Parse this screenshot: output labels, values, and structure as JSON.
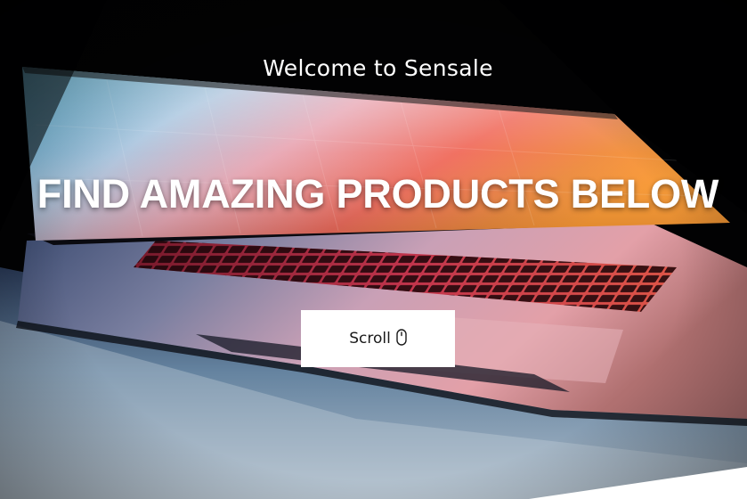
{
  "hero": {
    "welcome_text": "Welcome to Sensale",
    "headline": "FIND AMAZING PRODUCTS BELOW",
    "scroll_button_label": "Scroll",
    "scroll_icon": "mouse-icon",
    "background_image": "laptop-photo"
  }
}
